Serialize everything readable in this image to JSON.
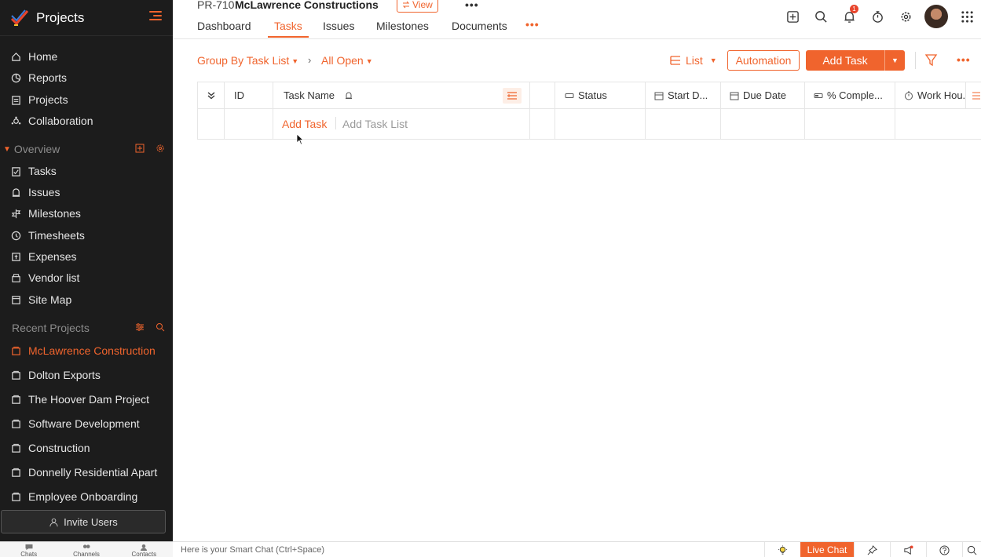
{
  "sidebar": {
    "brand": "Projects",
    "nav": [
      {
        "label": "Home",
        "icon": "home-icon"
      },
      {
        "label": "Reports",
        "icon": "reports-icon"
      },
      {
        "label": "Projects",
        "icon": "projects-icon"
      },
      {
        "label": "Collaboration",
        "icon": "collaboration-icon"
      }
    ],
    "overview_label": "Overview",
    "overview_items": [
      {
        "label": "Tasks",
        "icon": "tasks-icon"
      },
      {
        "label": "Issues",
        "icon": "issues-icon"
      },
      {
        "label": "Milestones",
        "icon": "milestones-icon"
      },
      {
        "label": "Timesheets",
        "icon": "timesheets-icon"
      },
      {
        "label": "Expenses",
        "icon": "expenses-icon"
      },
      {
        "label": "Vendor list",
        "icon": "vendor-icon"
      },
      {
        "label": "Site Map",
        "icon": "sitemap-icon"
      }
    ],
    "recent_label": "Recent Projects",
    "recent": [
      {
        "label": "McLawrence Construction"
      },
      {
        "label": "Dolton Exports"
      },
      {
        "label": "The Hoover Dam Project"
      },
      {
        "label": "Software Development"
      },
      {
        "label": "Construction"
      },
      {
        "label": "Donnelly Residential Apart"
      },
      {
        "label": "Employee Onboarding"
      }
    ],
    "invite": "Invite Users"
  },
  "header": {
    "project_id": "PR-710",
    "project_name": "McLawrence Constructions",
    "view_label": "View",
    "tabs": [
      {
        "label": "Dashboard"
      },
      {
        "label": "Tasks"
      },
      {
        "label": "Issues"
      },
      {
        "label": "Milestones"
      },
      {
        "label": "Documents"
      }
    ],
    "notification_count": "1"
  },
  "toolbar": {
    "group_by": "Group By Task List",
    "filter_view": "All Open",
    "list_label": "List",
    "automation": "Automation",
    "add_task": "Add Task"
  },
  "table": {
    "columns": [
      "ID",
      "Task Name",
      "Status",
      "Start D...",
      "Due Date",
      "% Comple...",
      "Work Hou..."
    ],
    "add_task_link": "Add Task",
    "add_task_list_link": "Add Task List"
  },
  "bottombar": {
    "items": [
      "Chats",
      "Channels",
      "Contacts"
    ],
    "smart_chat": "Here is your Smart Chat (Ctrl+Space)",
    "live_chat": "Live Chat"
  },
  "colors": {
    "accent": "#f0642d",
    "sidebar_bg": "#1c1c1c"
  }
}
